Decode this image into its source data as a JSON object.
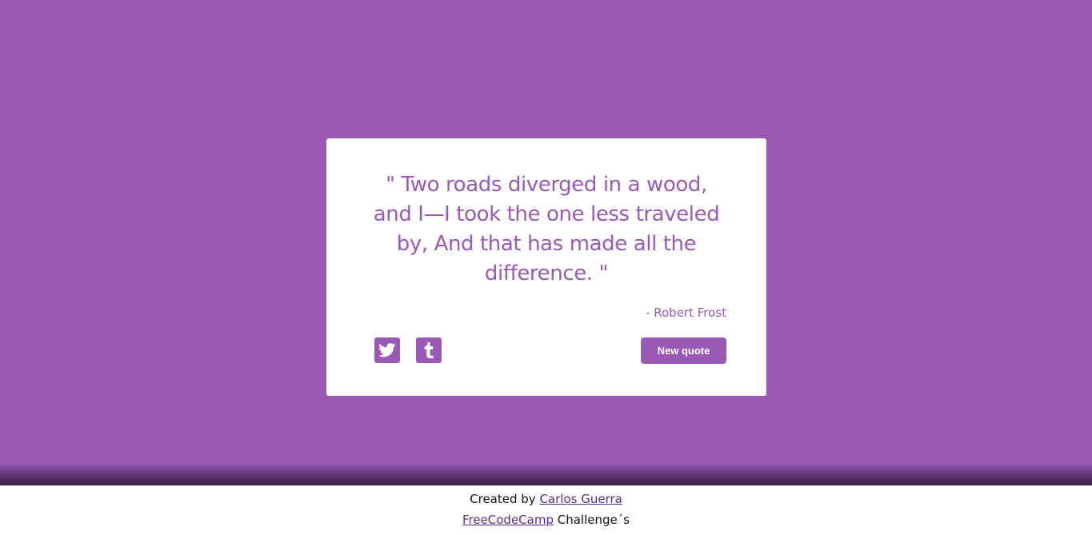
{
  "theme": {
    "accent": "#9b59b6",
    "card_background": "#ffffff",
    "icon_color": "#000000"
  },
  "header": {
    "icon": "moon-icon"
  },
  "quote": {
    "text": "\" Two roads diverged in a wood, and I—I took the one less traveled by, And that has made all the difference. \"",
    "author": "- Robert Frost"
  },
  "actions": {
    "twitter_icon": "twitter-icon",
    "tumblr_icon": "tumblr-icon",
    "new_quote_label": "New quote"
  },
  "footer": {
    "created_by_prefix": "Created by ",
    "author_link": "Carlos Guerra",
    "fcc_link": "FreeCodeCamp",
    "challenge_suffix": " Challenge´s"
  }
}
